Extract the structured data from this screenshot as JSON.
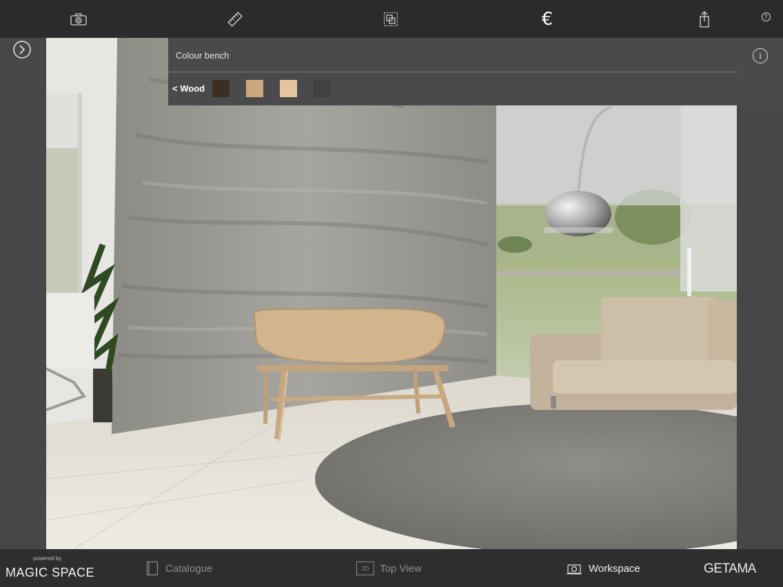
{
  "toolbar": {
    "icons": [
      "camera-icon",
      "ruler-icon",
      "layers-icon",
      "euro-icon",
      "share-icon",
      "help-icon"
    ],
    "euro_symbol": "€",
    "help_symbol": "?"
  },
  "panel": {
    "title": "Colour bench",
    "back_label": "< Wood",
    "info_symbol": "i",
    "swatches": [
      {
        "name": "dark-wood",
        "color": "#3b2e24"
      },
      {
        "name": "light-oak",
        "color": "#c9a97d"
      },
      {
        "name": "pale-beech",
        "color": "#e5c59c"
      },
      {
        "name": "charcoal",
        "color": "#414143"
      }
    ]
  },
  "bottombar": {
    "powered_by": "powered by",
    "brand_left": "MAGIC SPACE",
    "nav": [
      {
        "label": "Catalogue",
        "active": false
      },
      {
        "label": "Top View",
        "active": false,
        "badge": "2D"
      },
      {
        "label": "Workspace",
        "active": true
      }
    ],
    "brand_right": "GETAMA"
  },
  "colors": {
    "toolbar_bg": "#2b2b2d",
    "panel_bg": "#4a4a4c",
    "active_text": "#f2f2f2",
    "inactive_text": "#8d8d90"
  }
}
